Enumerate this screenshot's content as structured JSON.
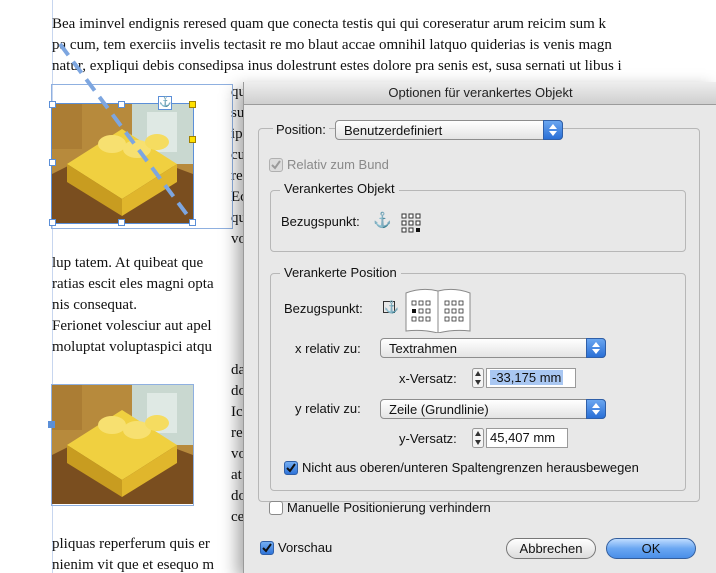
{
  "document": {
    "lines_full_top": [
      "Bea iminvel endignis reresed quam que conecta testis qui qui coreseratur arum reicim sum k",
      "pa cum, tem exerciis invelis tectasit re mo blaut accae omnihil latquo quiderias is venis magn",
      "natur, expliqui debis consedipsa inus dolestrunt estes dolore pra senis est, susa sernati ut libus i"
    ],
    "lines_narrow_1": [
      "qu",
      "su",
      "ip",
      "cu",
      "re",
      "Ec",
      "qu",
      "vo"
    ],
    "lines_full_mid": [
      "lup tatem. At quibeat que",
      "ratias escit eles magni opta",
      "nis consequat.",
      "Ferionet volesciur aut apel",
      "moluptat voluptaspici atqu"
    ],
    "lines_narrow_2": [
      "da",
      "do",
      "Ic",
      "re",
      "vo",
      "at",
      "do",
      "ce"
    ],
    "lines_full_bottom": [
      "pliquas reperferum quis er",
      "nienim vit que et esequo m"
    ],
    "anchor_glyph": "⚓"
  },
  "dialog": {
    "title": "Optionen für verankertes Objekt",
    "position_label": "Position:",
    "position_value": "Benutzerdefiniert",
    "relative_to_spine_label": "Relativ zum Bund",
    "relative_to_spine_checked": true,
    "anchored_object_group": "Verankertes Objekt",
    "reference_point_label": "Bezugspunkt:",
    "anchored_position_group": "Verankerte Position",
    "reference_point_label_2": "Bezugspunkt:",
    "x_relative_label": "x relativ zu:",
    "x_relative_value": "Textrahmen",
    "x_offset_label": "x-Versatz:",
    "x_offset_value": "-33,175 mm",
    "y_relative_label": "y relativ zu:",
    "y_relative_value": "Zeile (Grundlinie)",
    "y_offset_label": "y-Versatz:",
    "y_offset_value": "45,407 mm",
    "keep_within_columns_label": "Nicht aus oberen/unteren Spaltengrenzen herausbewegen",
    "keep_within_columns_checked": true,
    "prevent_manual_label": "Manuelle Positionierung verhindern",
    "prevent_manual_checked": false,
    "preview_label": "Vorschau",
    "preview_checked": true,
    "cancel_label": "Abbrechen",
    "ok_label": "OK"
  },
  "colors": {
    "accent": "#3b7fe0",
    "frame": "#5b8fd8",
    "dialog_bg": "#e8e8e8"
  }
}
